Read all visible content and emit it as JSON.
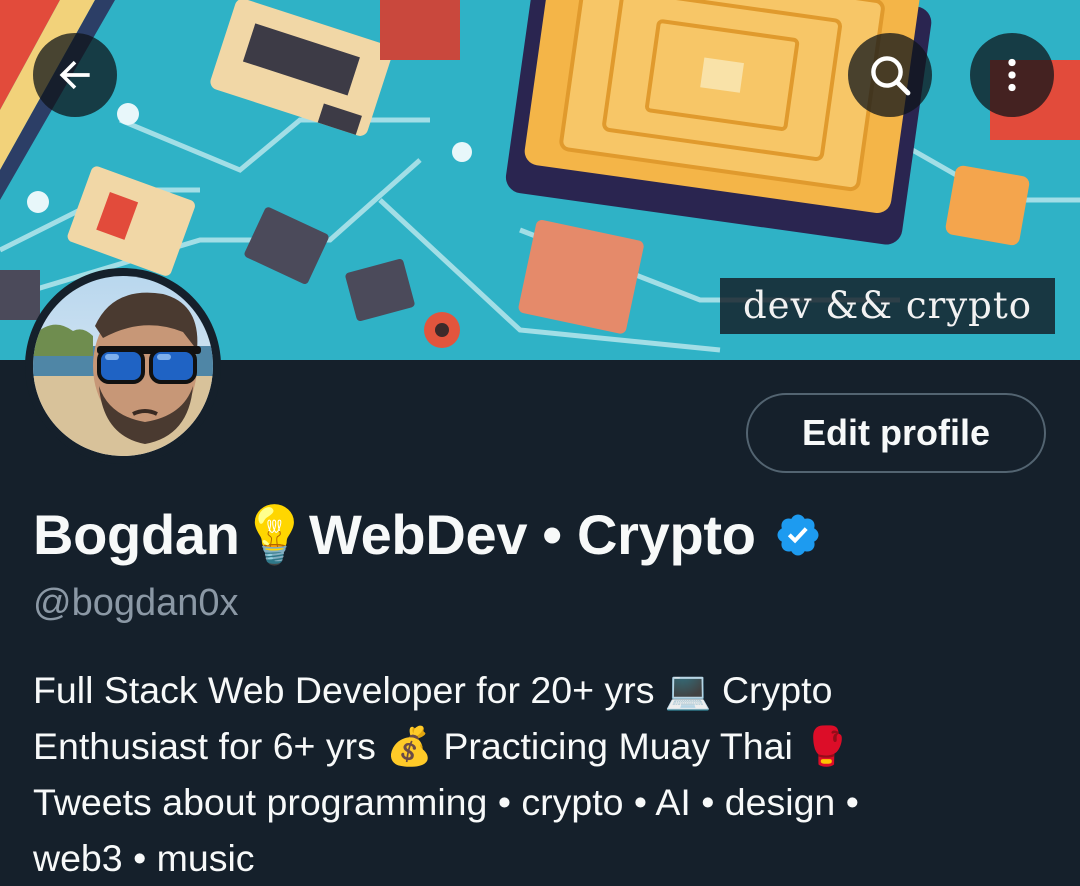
{
  "colors": {
    "background": "#15202b",
    "text_primary": "#f7f9f9",
    "text_secondary": "#8b98a5",
    "button_border": "#536471",
    "verified_blue": "#1d9bf0"
  },
  "header": {
    "back_icon": "arrow-left-icon",
    "search_icon": "search-icon",
    "more_icon": "more-vertical-icon"
  },
  "banner": {
    "caption": "dev && crypto"
  },
  "profile": {
    "edit_button_label": "Edit profile",
    "display_name": "Bogdan💡WebDev • Crypto",
    "verified_icon": "verified-badge-icon",
    "handle": "@bogdan0x",
    "bio_lines": [
      "Full Stack Web Developer for 20+ yrs 💻 Crypto",
      "Enthusiast for 6+ yrs 💰 Practicing Muay Thai 🥊",
      "Tweets about programming • crypto • AI • design •",
      "web3 • music"
    ]
  }
}
